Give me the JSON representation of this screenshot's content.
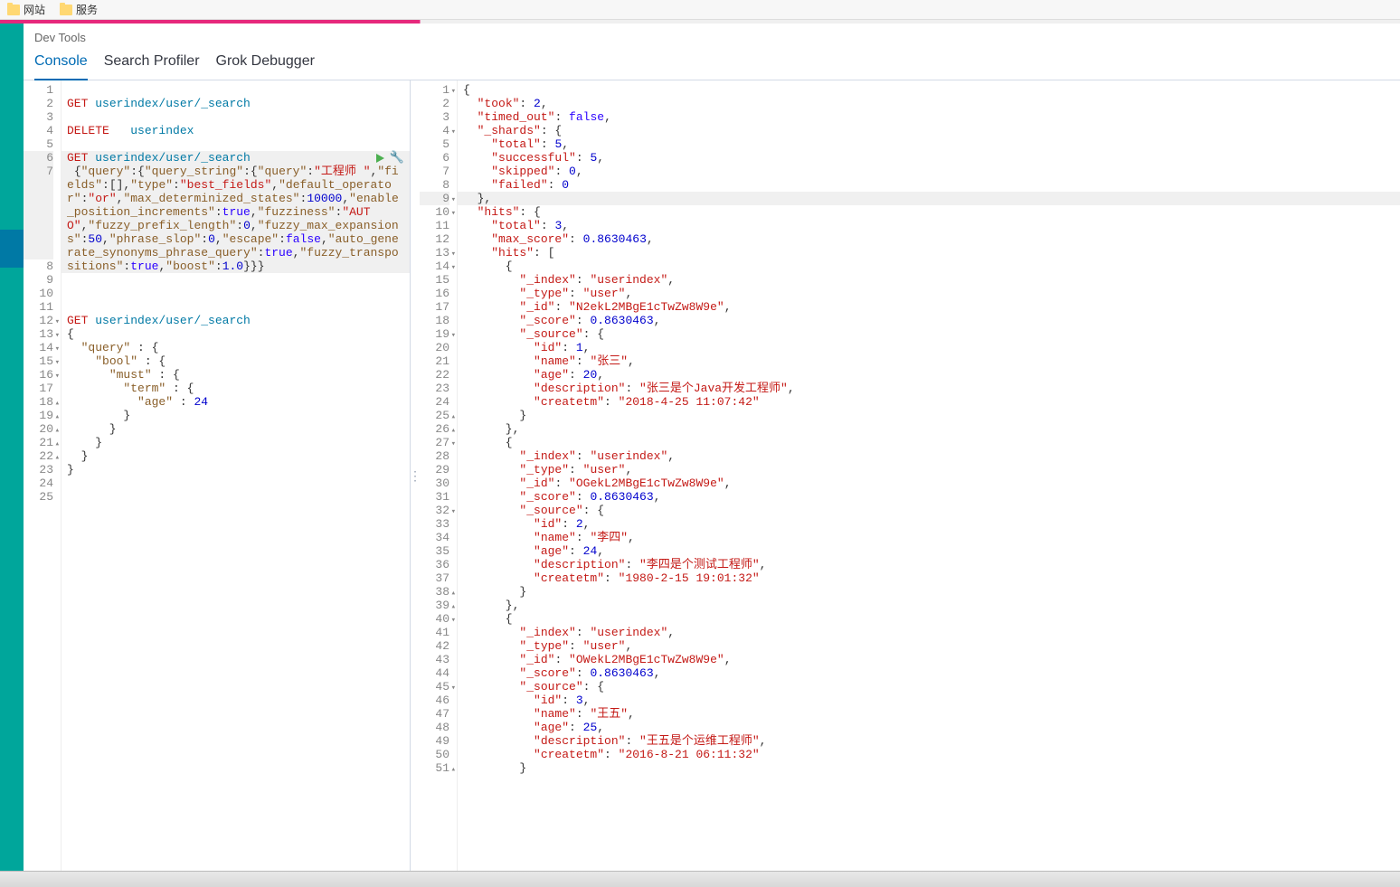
{
  "bookmarks": [
    "网站",
    "服务"
  ],
  "header": {
    "title": "Dev Tools"
  },
  "tabs": [
    {
      "label": "Console",
      "active": true
    },
    {
      "label": "Search Profiler",
      "active": false
    },
    {
      "label": "Grok Debugger",
      "active": false
    }
  ],
  "left_editor": {
    "lines": [
      {
        "n": 1,
        "text": "",
        "fold": ""
      },
      {
        "n": 2,
        "fold": "",
        "tokens": [
          [
            "method",
            "GET"
          ],
          [
            "plain",
            " "
          ],
          [
            "url",
            "userindex/user/_search"
          ]
        ]
      },
      {
        "n": 3,
        "text": "",
        "fold": ""
      },
      {
        "n": 4,
        "fold": "",
        "tokens": [
          [
            "method",
            "DELETE"
          ],
          [
            "plain",
            "   "
          ],
          [
            "url",
            "userindex"
          ]
        ]
      },
      {
        "n": 5,
        "text": "",
        "fold": ""
      },
      {
        "n": 6,
        "fold": "",
        "hl": true,
        "run": true,
        "tokens": [
          [
            "method",
            "GET"
          ],
          [
            "plain",
            " "
          ],
          [
            "url",
            "userindex/user/_search"
          ]
        ]
      },
      {
        "n": 7,
        "fold": "",
        "hlrange": true,
        "wrap": true,
        "html": " {<span class='tok-key'>\"query\"</span>:{<span class='tok-key'>\"query_string\"</span>:{<span class='tok-key'>\"query\"</span>:<span class='tok-str'>\"工程师 \"</span>,<span class='tok-key'>\"fields\"</span>:[],<span class='tok-key'>\"type\"</span>:<span class='tok-str'>\"best_fields\"</span>,<span class='tok-key'>\"default_operator\"</span>:<span class='tok-str'>\"or\"</span>,<span class='tok-key'>\"max_determinized_states\"</span>:<span class='tok-num'>10000</span>,<span class='tok-key'>\"enable_position_increments\"</span>:<span class='tok-bool'>true</span>,<span class='tok-key'>\"fuzziness\"</span>:<span class='tok-str'>\"AUTO\"</span>,<span class='tok-key'>\"fuzzy_prefix_length\"</span>:<span class='tok-num'>0</span>,<span class='tok-key'>\"fuzzy_max_expansions\"</span>:<span class='tok-num'>50</span>,<span class='tok-key'>\"phrase_slop\"</span>:<span class='tok-num'>0</span>,<span class='tok-key'>\"escape\"</span>:<span class='tok-bool'>false</span>,<span class='tok-key'>\"auto_generate_synonyms_phrase_query\"</span>:<span class='tok-bool'>true</span>,<span class='tok-key'>\"fuzzy_transpositions\"</span>:<span class='tok-bool'>true</span>,<span class='tok-key'>\"boost\"</span>:<span class='tok-num'>1.0</span>}}}"
      },
      {
        "n": 8,
        "text": "",
        "fold": ""
      },
      {
        "n": 9,
        "text": "",
        "fold": ""
      },
      {
        "n": 10,
        "text": "",
        "fold": ""
      },
      {
        "n": 11,
        "fold": "",
        "tokens": [
          [
            "method",
            "GET"
          ],
          [
            "plain",
            " "
          ],
          [
            "url",
            "userindex/user/_search"
          ]
        ]
      },
      {
        "n": 12,
        "fold": "▾",
        "text": "{"
      },
      {
        "n": 13,
        "fold": "▾",
        "html": "  <span class='tok-key'>\"query\"</span> : {"
      },
      {
        "n": 14,
        "fold": "▾",
        "html": "    <span class='tok-key'>\"bool\"</span> : {"
      },
      {
        "n": 15,
        "fold": "▾",
        "html": "      <span class='tok-key'>\"must\"</span> : {"
      },
      {
        "n": 16,
        "fold": "▾",
        "html": "        <span class='tok-key'>\"term\"</span> : {"
      },
      {
        "n": 17,
        "fold": "",
        "html": "          <span class='tok-key'>\"age\"</span> : <span class='tok-num'>24</span>"
      },
      {
        "n": 18,
        "fold": "▴",
        "text": "        }"
      },
      {
        "n": 19,
        "fold": "▴",
        "text": "      }"
      },
      {
        "n": 20,
        "fold": "▴",
        "text": "    }"
      },
      {
        "n": 21,
        "fold": "▴",
        "text": "  }"
      },
      {
        "n": 22,
        "fold": "▴",
        "text": "}"
      },
      {
        "n": 23,
        "text": "",
        "fold": ""
      },
      {
        "n": 24,
        "text": "",
        "fold": ""
      },
      {
        "n": 25,
        "text": "",
        "fold": ""
      }
    ]
  },
  "right_editor": {
    "lines": [
      {
        "n": 1,
        "fold": "▾",
        "text": "{"
      },
      {
        "n": 2,
        "fold": "",
        "html": "  <span class='tok-key2'>\"took\"</span>: <span class='tok-num'>2</span>,"
      },
      {
        "n": 3,
        "fold": "",
        "html": "  <span class='tok-key2'>\"timed_out\"</span>: <span class='tok-bool'>false</span>,"
      },
      {
        "n": 4,
        "fold": "▾",
        "html": "  <span class='tok-key2'>\"_shards\"</span>: {"
      },
      {
        "n": 5,
        "fold": "",
        "html": "    <span class='tok-key2'>\"total\"</span>: <span class='tok-num'>5</span>,"
      },
      {
        "n": 6,
        "fold": "",
        "html": "    <span class='tok-key2'>\"successful\"</span>: <span class='tok-num'>5</span>,"
      },
      {
        "n": 7,
        "fold": "",
        "html": "    <span class='tok-key2'>\"skipped\"</span>: <span class='tok-num'>0</span>,"
      },
      {
        "n": 8,
        "fold": "",
        "html": "    <span class='tok-key2'>\"failed\"</span>: <span class='tok-num'>0</span>"
      },
      {
        "n": 9,
        "fold": "▾",
        "hl": true,
        "text": "  },"
      },
      {
        "n": 10,
        "fold": "▾",
        "html": "  <span class='tok-key2'>\"hits\"</span>: {"
      },
      {
        "n": 11,
        "fold": "",
        "html": "    <span class='tok-key2'>\"total\"</span>: <span class='tok-num'>3</span>,"
      },
      {
        "n": 12,
        "fold": "",
        "html": "    <span class='tok-key2'>\"max_score\"</span>: <span class='tok-num'>0.8630463</span>,"
      },
      {
        "n": 13,
        "fold": "▾",
        "html": "    <span class='tok-key2'>\"hits\"</span>: ["
      },
      {
        "n": 14,
        "fold": "▾",
        "text": "      {"
      },
      {
        "n": 15,
        "fold": "",
        "html": "        <span class='tok-key2'>\"_index\"</span>: <span class='tok-str'>\"userindex\"</span>,"
      },
      {
        "n": 16,
        "fold": "",
        "html": "        <span class='tok-key2'>\"_type\"</span>: <span class='tok-str'>\"user\"</span>,"
      },
      {
        "n": 17,
        "fold": "",
        "html": "        <span class='tok-key2'>\"_id\"</span>: <span class='tok-str'>\"N2ekL2MBgE1cTwZw8W9e\"</span>,"
      },
      {
        "n": 18,
        "fold": "",
        "html": "        <span class='tok-key2'>\"_score\"</span>: <span class='tok-num'>0.8630463</span>,"
      },
      {
        "n": 19,
        "fold": "▾",
        "html": "        <span class='tok-key2'>\"_source\"</span>: {"
      },
      {
        "n": 20,
        "fold": "",
        "html": "          <span class='tok-key2'>\"id\"</span>: <span class='tok-num'>1</span>,"
      },
      {
        "n": 21,
        "fold": "",
        "html": "          <span class='tok-key2'>\"name\"</span>: <span class='tok-str'>\"张三\"</span>,"
      },
      {
        "n": 22,
        "fold": "",
        "html": "          <span class='tok-key2'>\"age\"</span>: <span class='tok-num'>20</span>,"
      },
      {
        "n": 23,
        "fold": "",
        "html": "          <span class='tok-key2'>\"description\"</span>: <span class='tok-str'>\"张三是个Java开发工程师\"</span>,"
      },
      {
        "n": 24,
        "fold": "",
        "html": "          <span class='tok-key2'>\"createtm\"</span>: <span class='tok-str'>\"2018-4-25 11:07:42\"</span>"
      },
      {
        "n": 25,
        "fold": "▴",
        "text": "        }"
      },
      {
        "n": 26,
        "fold": "▴",
        "text": "      },"
      },
      {
        "n": 27,
        "fold": "▾",
        "text": "      {"
      },
      {
        "n": 28,
        "fold": "",
        "html": "        <span class='tok-key2'>\"_index\"</span>: <span class='tok-str'>\"userindex\"</span>,"
      },
      {
        "n": 29,
        "fold": "",
        "html": "        <span class='tok-key2'>\"_type\"</span>: <span class='tok-str'>\"user\"</span>,"
      },
      {
        "n": 30,
        "fold": "",
        "html": "        <span class='tok-key2'>\"_id\"</span>: <span class='tok-str'>\"OGekL2MBgE1cTwZw8W9e\"</span>,"
      },
      {
        "n": 31,
        "fold": "",
        "html": "        <span class='tok-key2'>\"_score\"</span>: <span class='tok-num'>0.8630463</span>,"
      },
      {
        "n": 32,
        "fold": "▾",
        "html": "        <span class='tok-key2'>\"_source\"</span>: {"
      },
      {
        "n": 33,
        "fold": "",
        "html": "          <span class='tok-key2'>\"id\"</span>: <span class='tok-num'>2</span>,"
      },
      {
        "n": 34,
        "fold": "",
        "html": "          <span class='tok-key2'>\"name\"</span>: <span class='tok-str'>\"李四\"</span>,"
      },
      {
        "n": 35,
        "fold": "",
        "html": "          <span class='tok-key2'>\"age\"</span>: <span class='tok-num'>24</span>,"
      },
      {
        "n": 36,
        "fold": "",
        "html": "          <span class='tok-key2'>\"description\"</span>: <span class='tok-str'>\"李四是个测试工程师\"</span>,"
      },
      {
        "n": 37,
        "fold": "",
        "html": "          <span class='tok-key2'>\"createtm\"</span>: <span class='tok-str'>\"1980-2-15 19:01:32\"</span>"
      },
      {
        "n": 38,
        "fold": "▴",
        "text": "        }"
      },
      {
        "n": 39,
        "fold": "▴",
        "text": "      },"
      },
      {
        "n": 40,
        "fold": "▾",
        "text": "      {"
      },
      {
        "n": 41,
        "fold": "",
        "html": "        <span class='tok-key2'>\"_index\"</span>: <span class='tok-str'>\"userindex\"</span>,"
      },
      {
        "n": 42,
        "fold": "",
        "html": "        <span class='tok-key2'>\"_type\"</span>: <span class='tok-str'>\"user\"</span>,"
      },
      {
        "n": 43,
        "fold": "",
        "html": "        <span class='tok-key2'>\"_id\"</span>: <span class='tok-str'>\"OWekL2MBgE1cTwZw8W9e\"</span>,"
      },
      {
        "n": 44,
        "fold": "",
        "html": "        <span class='tok-key2'>\"_score\"</span>: <span class='tok-num'>0.8630463</span>,"
      },
      {
        "n": 45,
        "fold": "▾",
        "html": "        <span class='tok-key2'>\"_source\"</span>: {"
      },
      {
        "n": 46,
        "fold": "",
        "html": "          <span class='tok-key2'>\"id\"</span>: <span class='tok-num'>3</span>,"
      },
      {
        "n": 47,
        "fold": "",
        "html": "          <span class='tok-key2'>\"name\"</span>: <span class='tok-str'>\"王五\"</span>,"
      },
      {
        "n": 48,
        "fold": "",
        "html": "          <span class='tok-key2'>\"age\"</span>: <span class='tok-num'>25</span>,"
      },
      {
        "n": 49,
        "fold": "",
        "html": "          <span class='tok-key2'>\"description\"</span>: <span class='tok-str'>\"王五是个运维工程师\"</span>,"
      },
      {
        "n": 50,
        "fold": "",
        "html": "          <span class='tok-key2'>\"createtm\"</span>: <span class='tok-str'>\"2016-8-21 06:11:32\"</span>"
      },
      {
        "n": 51,
        "fold": "▴",
        "text": "        }"
      }
    ]
  }
}
